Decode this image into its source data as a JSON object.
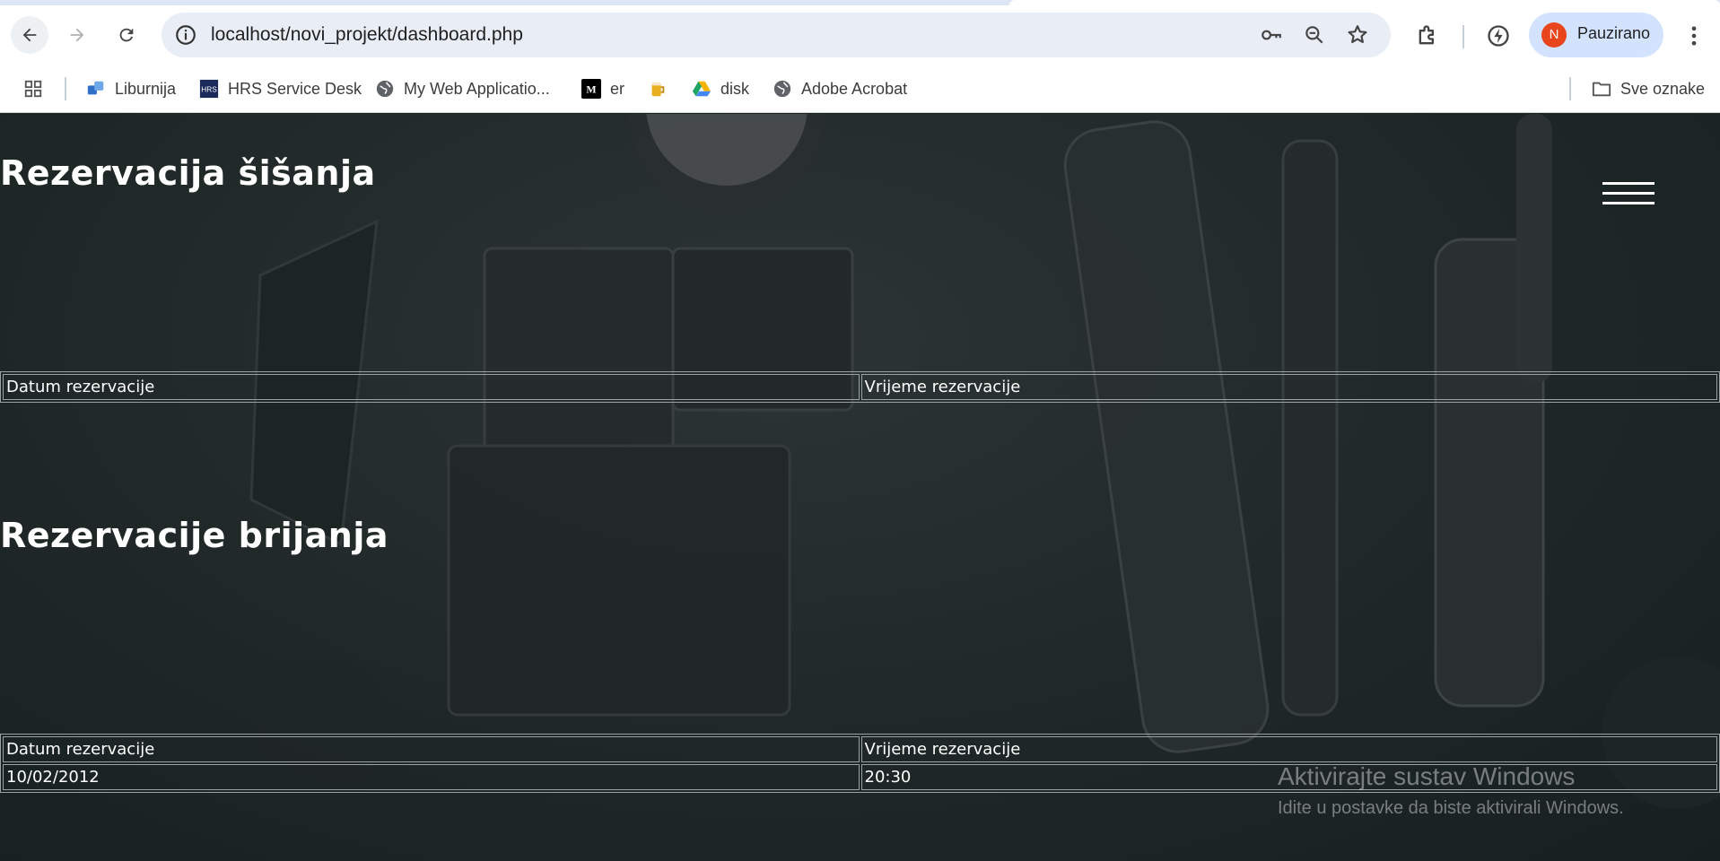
{
  "browser": {
    "url": "localhost/novi_projekt/dashboard.php",
    "profile_initial": "N",
    "profile_name": "Pauzirano",
    "bookmarks": [
      {
        "label": "Liburnija",
        "icon": "liburnija-icon"
      },
      {
        "label": "HRS Service Desk",
        "icon": "hrs-icon"
      },
      {
        "label": "My Web Applicatio...",
        "icon": "globe-icon"
      },
      {
        "label": "er",
        "icon": "medium-icon"
      },
      {
        "label": "",
        "icon": "beer-icon"
      },
      {
        "label": "disk",
        "icon": "google-drive-icon"
      },
      {
        "label": "Adobe Acrobat",
        "icon": "globe-icon"
      }
    ],
    "all_bookmarks_label": "Sve oznake"
  },
  "page": {
    "sections": [
      {
        "title": "Rezervacija šišanja",
        "headers": [
          "Datum rezervacije",
          "Vrijeme rezervacije"
        ],
        "rows": []
      },
      {
        "title": "Rezervacije brijanja",
        "headers": [
          "Datum rezervacije",
          "Vrijeme rezervacije"
        ],
        "rows": [
          [
            "10/02/2012",
            "20:30"
          ]
        ]
      }
    ]
  },
  "windows_watermark": {
    "title": "Aktivirajte sustav Windows",
    "subtitle": "Idite u postavke da biste aktivirali Windows."
  },
  "colors": {
    "page_bg": "#1c2222",
    "text": "#ffffff",
    "table_border": "#9aa3a3",
    "omnibox": "#e9eef6",
    "profile_pill": "#d3e3fd",
    "avatar": "#e8451c"
  }
}
